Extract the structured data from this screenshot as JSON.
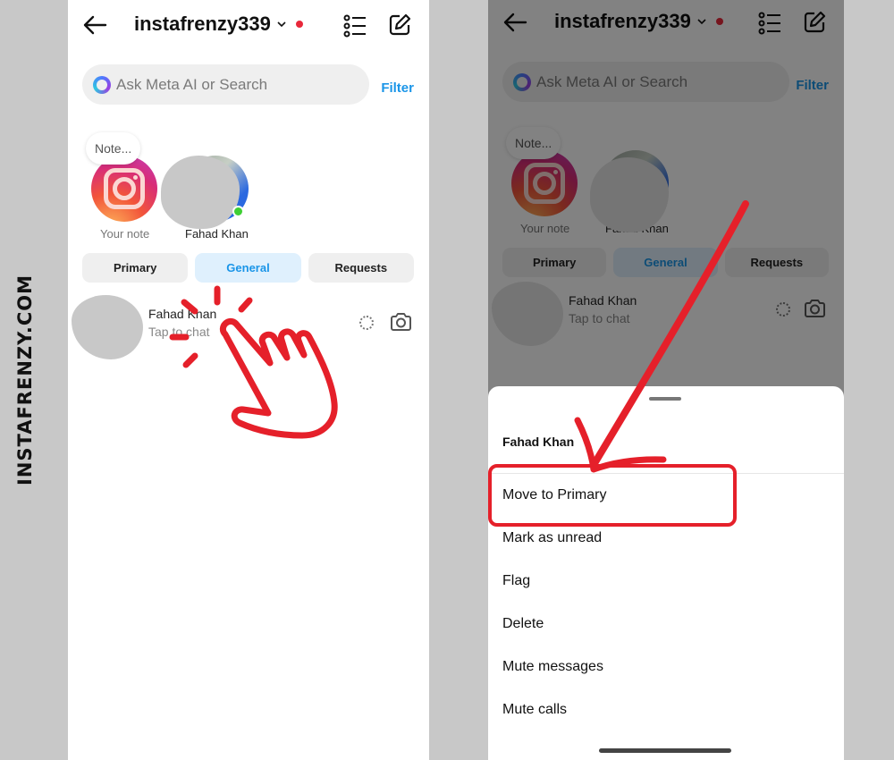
{
  "watermark": "INSTAFRENZY.COM",
  "colors": {
    "accent": "#1a95e8",
    "annotation": "#e5202a",
    "online": "#3fcf34",
    "notification_dot": "#e8283a"
  },
  "header": {
    "title": "instafrenzy339",
    "icons": [
      "back-arrow-icon",
      "chevron-down-icon",
      "list-icon",
      "edit-icon"
    ]
  },
  "search": {
    "placeholder": "Ask Meta AI or Search",
    "icon": "meta-ai-ring-icon",
    "filter_label": "Filter"
  },
  "notes": {
    "bubble_text": "Note...",
    "my_note_label": "Your note",
    "friend_label": "Fahad Khan"
  },
  "tabs": [
    {
      "label": "Primary",
      "active": false
    },
    {
      "label": "General",
      "active": true
    },
    {
      "label": "Requests",
      "active": false
    }
  ],
  "chats": [
    {
      "name": "Fahad Khan",
      "subtitle": "Tap to chat",
      "icons": [
        "dotted-circle-icon",
        "camera-icon"
      ]
    }
  ],
  "sheet": {
    "title": "Fahad Khan",
    "items": [
      {
        "label": "Move to Primary",
        "highlighted": true
      },
      {
        "label": "Mark as unread"
      },
      {
        "label": "Flag"
      },
      {
        "label": "Delete"
      },
      {
        "label": "Mute messages"
      },
      {
        "label": "Mute calls"
      }
    ]
  },
  "annotations": [
    "tap-hand-icon",
    "red-arrow",
    "highlight-box"
  ]
}
